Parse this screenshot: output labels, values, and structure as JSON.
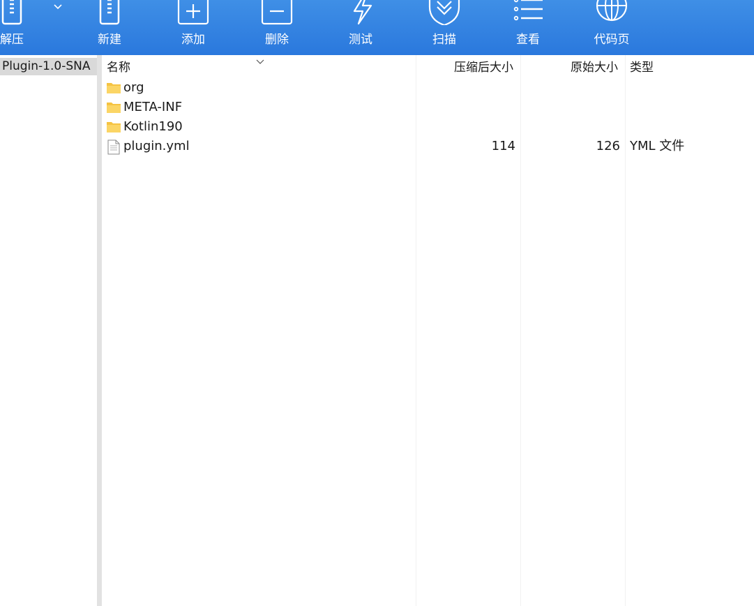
{
  "toolbar": {
    "buttons": [
      {
        "label": "解压",
        "icon": "extract-icon"
      },
      {
        "label": "新建",
        "icon": "new-archive-icon"
      },
      {
        "label": "添加",
        "icon": "add-icon"
      },
      {
        "label": "删除",
        "icon": "delete-icon"
      },
      {
        "label": "测试",
        "icon": "test-icon"
      },
      {
        "label": "扫描",
        "icon": "scan-shield-icon"
      },
      {
        "label": "查看",
        "icon": "view-list-icon"
      },
      {
        "label": "代码页",
        "icon": "codepage-globe-icon"
      }
    ]
  },
  "tree": {
    "selected": "Plugin-1.0-SNA"
  },
  "columns": {
    "name": "名称",
    "compressed": "压缩后大小",
    "original": "原始大小",
    "type": "类型"
  },
  "files": [
    {
      "name": "org",
      "kind": "folder",
      "compressed": "",
      "original": "",
      "type": ""
    },
    {
      "name": "META-INF",
      "kind": "folder",
      "compressed": "",
      "original": "",
      "type": ""
    },
    {
      "name": "Kotlin190",
      "kind": "folder",
      "compressed": "",
      "original": "",
      "type": ""
    },
    {
      "name": "plugin.yml",
      "kind": "file",
      "compressed": "114",
      "original": "126",
      "type": "YML 文件"
    }
  ],
  "colors": {
    "toolbar": "#2a78dd",
    "folder": "#f5c342",
    "selection": "#d9d9d9"
  }
}
